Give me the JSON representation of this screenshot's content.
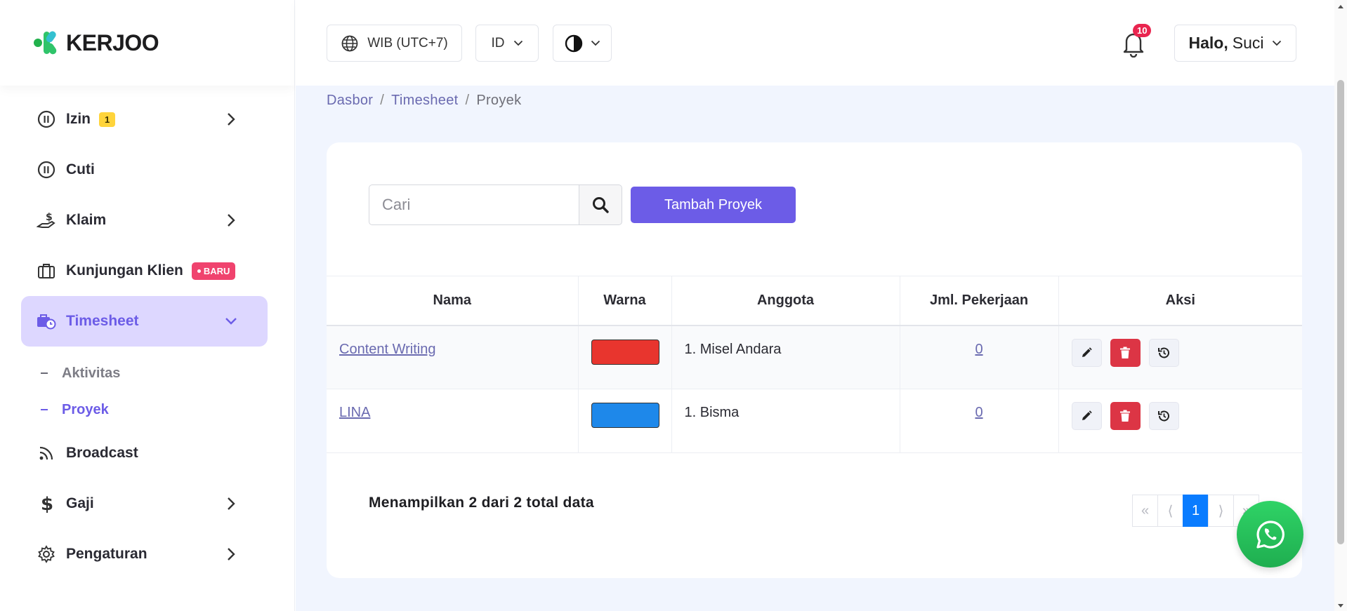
{
  "brand": {
    "name": "KERJOO"
  },
  "sidebar": {
    "items": [
      {
        "label": "Izin",
        "badge": "1",
        "icon": "pause-circle-icon"
      },
      {
        "label": "Cuti",
        "icon": "pause-circle-icon"
      },
      {
        "label": "Klaim",
        "icon": "hand-dollar-icon"
      },
      {
        "label": "Kunjungan Klien",
        "badge_new": "BARU",
        "icon": "briefcase-icon"
      },
      {
        "label": "Timesheet",
        "icon": "briefcase-clock-icon",
        "active": true
      },
      {
        "label": "Broadcast",
        "icon": "rss-icon"
      },
      {
        "label": "Gaji",
        "icon": "dollar-icon"
      },
      {
        "label": "Pengaturan",
        "icon": "gear-icon"
      }
    ],
    "sub_items": [
      {
        "label": "Aktivitas"
      },
      {
        "label": "Proyek",
        "active": true
      }
    ]
  },
  "topbar": {
    "timezone": "WIB (UTC+7)",
    "language": "ID",
    "notifications_count": "10",
    "greeting": "Halo,",
    "user_name": "Suci"
  },
  "breadcrumb": [
    "Dasbor",
    "Timesheet",
    "Proyek"
  ],
  "search": {
    "placeholder": "Cari"
  },
  "add_button": "Tambah Proyek",
  "table": {
    "headers": [
      "Nama",
      "Warna",
      "Anggota",
      "Jml. Pekerjaan",
      "Aksi"
    ],
    "rows": [
      {
        "name": "Content Writing",
        "color": "#e8352e",
        "member": "1. Misel Andara",
        "jobs": "0"
      },
      {
        "name": "LINA",
        "color": "#1e88ea",
        "member": "1. Bisma",
        "jobs": "0"
      }
    ]
  },
  "info": "Menampilkan 2 dari 2 total data",
  "pagination": {
    "first": "«",
    "prev": "⟨",
    "current": "1",
    "next": "⟩",
    "last": "»"
  },
  "colors": {
    "accent": "#6c5ce7",
    "danger": "#dc3545",
    "page_active": "#0a7cff",
    "whatsapp": "#25d366"
  }
}
